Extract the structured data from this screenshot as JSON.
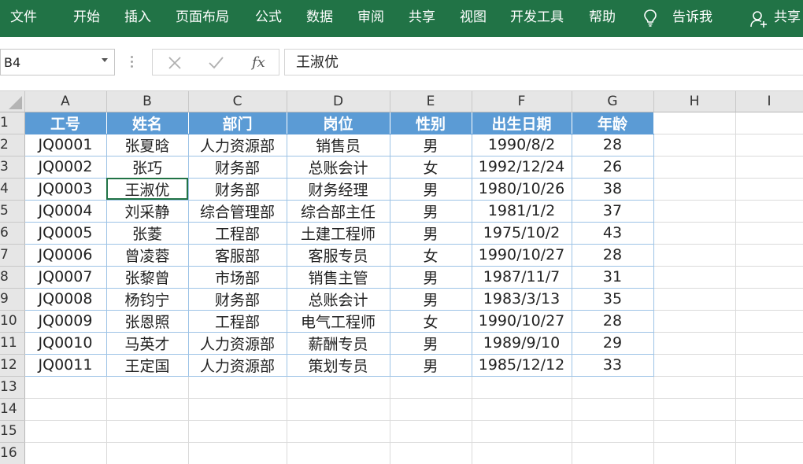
{
  "ribbon": {
    "tabs": [
      "文件",
      "开始",
      "插入",
      "页面布局",
      "公式",
      "数据",
      "审阅",
      "共享",
      "视图",
      "开发工具",
      "帮助"
    ],
    "tell_me": "告诉我",
    "share": "共享",
    "bg_color": "#217346"
  },
  "formula_bar": {
    "name_box": "B4",
    "fx_label": "fx",
    "formula": "王淑优"
  },
  "columns": [
    "A",
    "B",
    "C",
    "D",
    "E",
    "F",
    "G",
    "H",
    "I"
  ],
  "row_numbers": [
    "1",
    "2",
    "3",
    "4",
    "5",
    "6",
    "7",
    "8",
    "9",
    "10",
    "11",
    "12",
    "13",
    "14",
    "15",
    "16"
  ],
  "table": {
    "header_color": "#5b9bd5",
    "headers": [
      "工号",
      "姓名",
      "部门",
      "岗位",
      "性别",
      "出生日期",
      "年龄"
    ],
    "rows": [
      [
        "JQ0001",
        "张夏晗",
        "人力资源部",
        "销售员",
        "男",
        "1990/8/2",
        "28"
      ],
      [
        "JQ0002",
        "张巧",
        "财务部",
        "总账会计",
        "女",
        "1992/12/24",
        "26"
      ],
      [
        "JQ0003",
        "王淑优",
        "财务部",
        "财务经理",
        "男",
        "1980/10/26",
        "38"
      ],
      [
        "JQ0004",
        "刘采静",
        "综合管理部",
        "综合部主任",
        "男",
        "1981/1/2",
        "37"
      ],
      [
        "JQ0005",
        "张菱",
        "工程部",
        "土建工程师",
        "男",
        "1975/10/2",
        "43"
      ],
      [
        "JQ0006",
        "曾凌蓉",
        "客服部",
        "客服专员",
        "女",
        "1990/10/27",
        "28"
      ],
      [
        "JQ0007",
        "张黎曾",
        "市场部",
        "销售主管",
        "男",
        "1987/11/7",
        "31"
      ],
      [
        "JQ0008",
        "杨钧宁",
        "财务部",
        "总账会计",
        "男",
        "1983/3/13",
        "35"
      ],
      [
        "JQ0009",
        "张恩照",
        "工程部",
        "电气工程师",
        "女",
        "1990/10/27",
        "28"
      ],
      [
        "JQ0010",
        "马英才",
        "人力资源部",
        "薪酬专员",
        "男",
        "1989/9/10",
        "29"
      ],
      [
        "JQ0011",
        "王定国",
        "人力资源部",
        "策划专员",
        "男",
        "1985/12/12",
        "33"
      ]
    ]
  }
}
